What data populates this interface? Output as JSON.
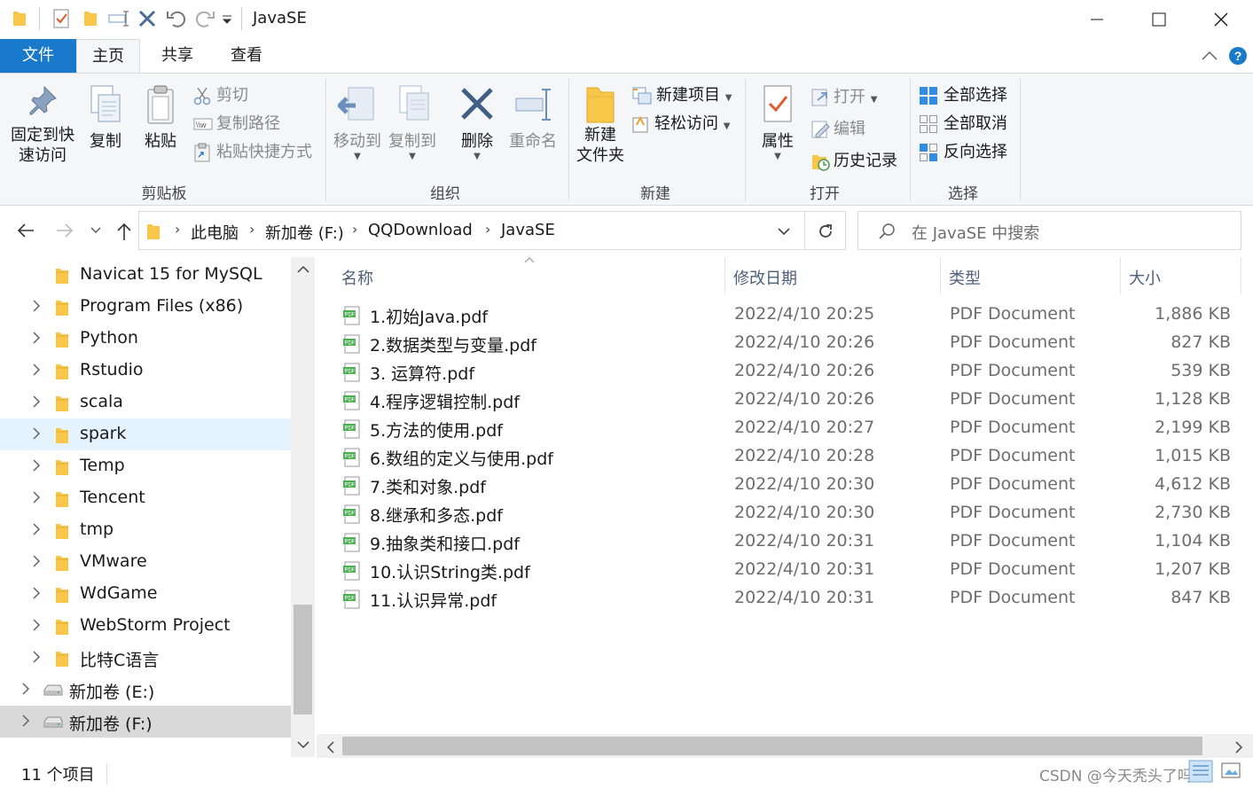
{
  "window": {
    "title": "JavaSE"
  },
  "tabs": [
    "文件",
    "主页",
    "共享",
    "查看"
  ],
  "ribbon": {
    "clipboard": {
      "pin": [
        "固定到快",
        "速访问"
      ],
      "copy": "复制",
      "paste": "粘贴",
      "cut": "剪切",
      "copy_path": "复制路径",
      "paste_shortcut": "粘贴快捷方式",
      "label": "剪贴板"
    },
    "organize": {
      "move_to": "移动到",
      "copy_to": "复制到",
      "delete": "删除",
      "rename": "重命名",
      "label": "组织"
    },
    "new": {
      "new_folder": [
        "新建",
        "文件夹"
      ],
      "new_item": "新建项目",
      "easy_access": "轻松访问",
      "label": "新建"
    },
    "open": {
      "properties": "属性",
      "open": "打开",
      "edit": "编辑",
      "history": "历史记录",
      "label": "打开"
    },
    "select": {
      "select_all": "全部选择",
      "select_none": "全部取消",
      "invert": "反向选择",
      "label": "选择"
    }
  },
  "address": {
    "crumbs": [
      "此电脑",
      "新加卷 (F:)",
      "QQDownload",
      "JavaSE"
    ],
    "search_placeholder": "在 JavaSE 中搜索"
  },
  "nav": [
    {
      "label": "Navicat 15 for MySQL",
      "expander": false
    },
    {
      "label": "Program Files (x86)",
      "expander": true
    },
    {
      "label": "Python",
      "expander": true
    },
    {
      "label": "Rstudio",
      "expander": true
    },
    {
      "label": "scala",
      "expander": true
    },
    {
      "label": "spark",
      "expander": true,
      "selected": true
    },
    {
      "label": "Temp",
      "expander": true
    },
    {
      "label": "Tencent",
      "expander": true
    },
    {
      "label": "tmp",
      "expander": true
    },
    {
      "label": "VMware",
      "expander": true
    },
    {
      "label": "WdGame",
      "expander": true
    },
    {
      "label": "WebStorm Project",
      "expander": true
    },
    {
      "label": "比特C语言",
      "expander": true
    },
    {
      "label": "新加卷 (E:)",
      "expander": true,
      "drive": true
    },
    {
      "label": "新加卷 (F:)",
      "expander": true,
      "drive": true,
      "active": true
    }
  ],
  "columns": {
    "name": "名称",
    "date": "修改日期",
    "type": "类型",
    "size": "大小"
  },
  "files": [
    {
      "name": "1.初始Java.pdf",
      "date": "2022/4/10 20:25",
      "type": "PDF Document",
      "size": "1,886 KB"
    },
    {
      "name": "2.数据类型与变量.pdf",
      "date": "2022/4/10 20:26",
      "type": "PDF Document",
      "size": "827 KB"
    },
    {
      "name": "3. 运算符.pdf",
      "date": "2022/4/10 20:26",
      "type": "PDF Document",
      "size": "539 KB"
    },
    {
      "name": "4.程序逻辑控制.pdf",
      "date": "2022/4/10 20:26",
      "type": "PDF Document",
      "size": "1,128 KB"
    },
    {
      "name": "5.方法的使用.pdf",
      "date": "2022/4/10 20:27",
      "type": "PDF Document",
      "size": "2,199 KB"
    },
    {
      "name": "6.数组的定义与使用.pdf",
      "date": "2022/4/10 20:28",
      "type": "PDF Document",
      "size": "1,015 KB"
    },
    {
      "name": "7.类和对象.pdf",
      "date": "2022/4/10 20:30",
      "type": "PDF Document",
      "size": "4,612 KB"
    },
    {
      "name": "8.继承和多态.pdf",
      "date": "2022/4/10 20:30",
      "type": "PDF Document",
      "size": "2,730 KB"
    },
    {
      "name": "9.抽象类和接口.pdf",
      "date": "2022/4/10 20:31",
      "type": "PDF Document",
      "size": "1,104 KB"
    },
    {
      "name": "10.认识String类.pdf",
      "date": "2022/4/10 20:31",
      "type": "PDF Document",
      "size": "1,207 KB"
    },
    {
      "name": "11.认识异常.pdf",
      "date": "2022/4/10 20:31",
      "type": "PDF Document",
      "size": "847 KB"
    }
  ],
  "status": {
    "count": "11 个项目",
    "watermark": "CSDN @今天秃头了吗？"
  },
  "colors": {
    "file_tab": "#1979ca",
    "selected_row": "#e5f3ff",
    "active_row": "#d9d9d9",
    "folder": "#f8c74a"
  }
}
